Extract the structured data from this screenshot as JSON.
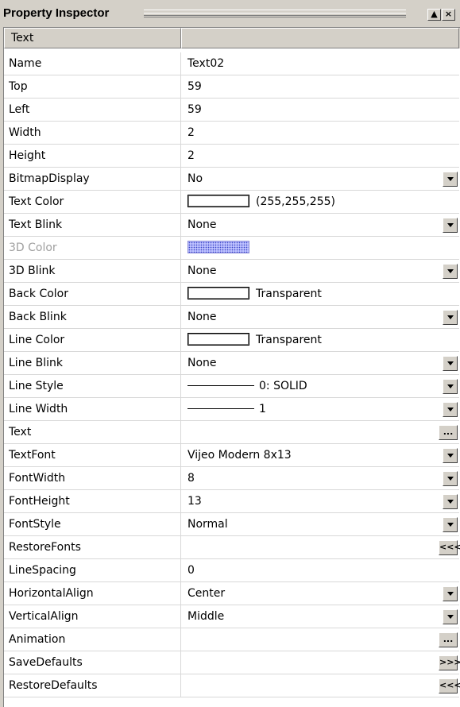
{
  "panel": {
    "title": "Property Inspector",
    "btn_restore": "▲",
    "btn_close": "×"
  },
  "header": {
    "col1": "Text",
    "col2": ""
  },
  "properties": [
    {
      "name": "Name",
      "value": "Text02",
      "control": "none"
    },
    {
      "name": "Top",
      "value": "59",
      "control": "none"
    },
    {
      "name": "Left",
      "value": "59",
      "control": "none"
    },
    {
      "name": "Width",
      "value": "2",
      "control": "none"
    },
    {
      "name": "Height",
      "value": "2",
      "control": "none"
    },
    {
      "name": "BitmapDisplay",
      "value": "No",
      "control": "dropdown"
    },
    {
      "name": "Text Color",
      "value": "(255,255,255)",
      "control": "none",
      "swatch": "white"
    },
    {
      "name": "Text Blink",
      "value": "None",
      "control": "dropdown"
    },
    {
      "name": "3D Color",
      "value": "",
      "control": "none",
      "swatch": "3d",
      "disabled": true
    },
    {
      "name": "3D Blink",
      "value": "None",
      "control": "dropdown"
    },
    {
      "name": "Back Color",
      "value": "Transparent",
      "control": "none",
      "swatch": "white"
    },
    {
      "name": "Back Blink",
      "value": "None",
      "control": "dropdown"
    },
    {
      "name": "Line Color",
      "value": "Transparent",
      "control": "none",
      "swatch": "white"
    },
    {
      "name": "Line Blink",
      "value": "None",
      "control": "dropdown"
    },
    {
      "name": "Line Style",
      "value": "0: SOLID",
      "control": "dropdown",
      "line": true
    },
    {
      "name": "Line Width",
      "value": "1",
      "control": "dropdown",
      "line": true
    },
    {
      "name": "Text",
      "value": "",
      "control": "ellipsis",
      "button_label": "..."
    },
    {
      "name": "TextFont",
      "value": "Vijeo Modern 8x13",
      "control": "dropdown"
    },
    {
      "name": "FontWidth",
      "value": "8",
      "control": "dropdown"
    },
    {
      "name": "FontHeight",
      "value": "13",
      "control": "dropdown"
    },
    {
      "name": "FontStyle",
      "value": "Normal",
      "control": "dropdown"
    },
    {
      "name": "RestoreFonts",
      "value": "",
      "control": "button",
      "button_label": "<<<"
    },
    {
      "name": "LineSpacing",
      "value": "0",
      "control": "none"
    },
    {
      "name": "HorizontalAlign",
      "value": "Center",
      "control": "dropdown"
    },
    {
      "name": "VerticalAlign",
      "value": "Middle",
      "control": "dropdown"
    },
    {
      "name": "Animation",
      "value": "",
      "control": "ellipsis",
      "button_label": "..."
    },
    {
      "name": "SaveDefaults",
      "value": "",
      "control": "button",
      "button_label": ">>>"
    },
    {
      "name": "RestoreDefaults",
      "value": "",
      "control": "button",
      "button_label": "<<<"
    }
  ]
}
